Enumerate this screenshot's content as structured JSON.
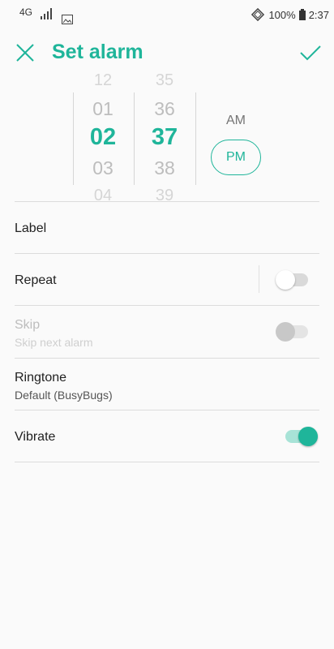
{
  "status_bar": {
    "network": "4G",
    "battery": "100%",
    "time": "2:37"
  },
  "app_bar": {
    "title": "Set alarm"
  },
  "time_picker": {
    "hours": [
      "12",
      "01",
      "02",
      "03",
      "04"
    ],
    "minutes": [
      "35",
      "36",
      "37",
      "38",
      "39"
    ],
    "selected_hour": "02",
    "selected_minute": "37",
    "am_label": "AM",
    "pm_label": "PM",
    "selected_period": "PM"
  },
  "settings": {
    "label": {
      "title": "Label"
    },
    "repeat": {
      "title": "Repeat",
      "enabled": false
    },
    "skip": {
      "title": "Skip",
      "subtitle": "Skip next alarm",
      "enabled": false
    },
    "ringtone": {
      "title": "Ringtone",
      "subtitle": "Default (BusyBugs)"
    },
    "vibrate": {
      "title": "Vibrate",
      "enabled": true
    }
  },
  "colors": {
    "accent": "#1fb59a",
    "accent_light": "#a8e3d7"
  }
}
